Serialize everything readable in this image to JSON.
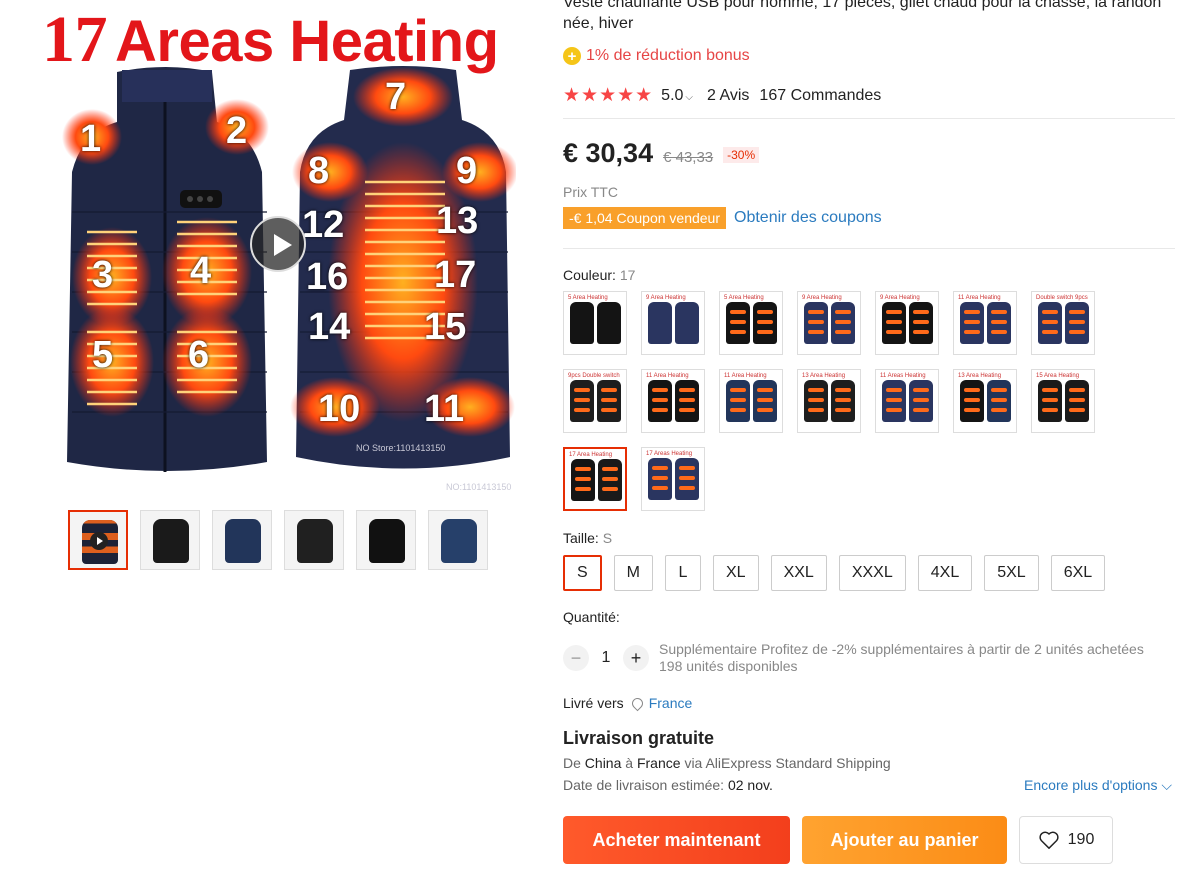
{
  "product": {
    "title": "Veste chauffante USB pour homme, 17 pièces, gilet chaud pour la chasse, la randon née, hiver",
    "bonus_text": "1% de réduction bonus",
    "bonus_icon": "plus-circle-icon",
    "rating": "5.0",
    "stars": "★★★★★",
    "reviews": "2 Avis",
    "orders": "167 Commandes"
  },
  "gallery": {
    "banner_number": "17",
    "banner_text": "Areas Heating",
    "watermark_1": "NO Store:1101413150",
    "watermark_2": "NO:1101413150",
    "zones_left": [
      "1",
      "2",
      "3",
      "4",
      "5",
      "6"
    ],
    "zones_right": [
      "7",
      "8",
      "9",
      "12",
      "13",
      "16",
      "17",
      "14",
      "15",
      "10",
      "11"
    ],
    "thumbnails": [
      {
        "name": "thumb-heated-vest-video",
        "color": "#1c2237"
      },
      {
        "name": "thumb-black-vest",
        "color": "#1a1a1a"
      },
      {
        "name": "thumb-navy-vest",
        "color": "#22355a"
      },
      {
        "name": "thumb-black-vest-front",
        "color": "#202020"
      },
      {
        "name": "thumb-black-vest-back",
        "color": "#111111"
      },
      {
        "name": "thumb-navy-vest-back",
        "color": "#26406a"
      }
    ]
  },
  "pricing": {
    "price": "€ 30,34",
    "old_price": "€ 43,33",
    "discount": "-30%",
    "tax_note": "Prix TTC",
    "coupon": "-€ 1,04 Coupon vendeur",
    "coupon_link": "Obtenir des coupons"
  },
  "color": {
    "label": "Couleur:",
    "selected": "17",
    "swatches": [
      {
        "a": "#141414",
        "b": "#141414",
        "heat": false,
        "top": "5 Area Heating"
      },
      {
        "a": "#2a3560",
        "b": "#2a3560",
        "heat": false,
        "top": "9 Area Heating"
      },
      {
        "a": "#141414",
        "b": "#141414",
        "heat": true,
        "top": "5 Area Heating"
      },
      {
        "a": "#2a3560",
        "b": "#2a3560",
        "heat": true,
        "top": "9 Area Heating"
      },
      {
        "a": "#141414",
        "b": "#141414",
        "heat": true,
        "top": "9 Area Heating"
      },
      {
        "a": "#2a3560",
        "b": "#2a3560",
        "heat": true,
        "top": "11 Area Heating"
      },
      {
        "a": "#2a3560",
        "b": "#2a3560",
        "heat": true,
        "top": "Double switch 9pcs"
      },
      {
        "a": "#1e1e1e",
        "b": "#1e1e1e",
        "heat": true,
        "top": "9pcs Double switch"
      },
      {
        "a": "#141414",
        "b": "#141414",
        "heat": true,
        "top": "11 Area Heating"
      },
      {
        "a": "#22355a",
        "b": "#22355a",
        "heat": true,
        "top": "11 Area Heating"
      },
      {
        "a": "#1e1e1e",
        "b": "#1e1e1e",
        "heat": true,
        "top": "13 Area Heating"
      },
      {
        "a": "#2a3560",
        "b": "#2a3560",
        "heat": true,
        "top": "11 Areas Heating"
      },
      {
        "a": "#141414",
        "b": "#22355a",
        "heat": true,
        "top": "13 Area Heating"
      },
      {
        "a": "#1a1a1a",
        "b": "#1a1a1a",
        "heat": true,
        "top": "15 Area Heating"
      },
      {
        "a": "#141414",
        "b": "#1a1a1a",
        "heat": true,
        "top": "17 Area Heating"
      },
      {
        "a": "#2a3560",
        "b": "#2a3560",
        "heat": true,
        "top": "17 Areas Heating"
      }
    ],
    "selected_index": 14
  },
  "size": {
    "label": "Taille:",
    "selected": "S",
    "options": [
      "S",
      "M",
      "L",
      "XL",
      "XXL",
      "XXXL",
      "4XL",
      "5XL",
      "6XL"
    ]
  },
  "quantity": {
    "label": "Quantité:",
    "value": "1",
    "promo": "Supplémentaire Profitez de -2% supplémentaires à partir de 2 unités achetées",
    "stock": "198 unités disponibles"
  },
  "shipping": {
    "ship_to_label": "Livré vers",
    "country": "France",
    "free_label": "Livraison gratuite",
    "from_prefix": "De",
    "origin": "China",
    "to_word": "à",
    "destination": "France",
    "via": "via AliExpress Standard Shipping",
    "date_label": "Date de livraison estimée:",
    "date": "02 nov.",
    "more_options": "Encore plus d'options"
  },
  "actions": {
    "buy": "Acheter maintenant",
    "cart": "Ajouter au panier",
    "wishlist_count": "190"
  },
  "colors": {
    "accent": "#e62e04",
    "link": "#2b7bbf",
    "heat": "#ff6a1a"
  }
}
